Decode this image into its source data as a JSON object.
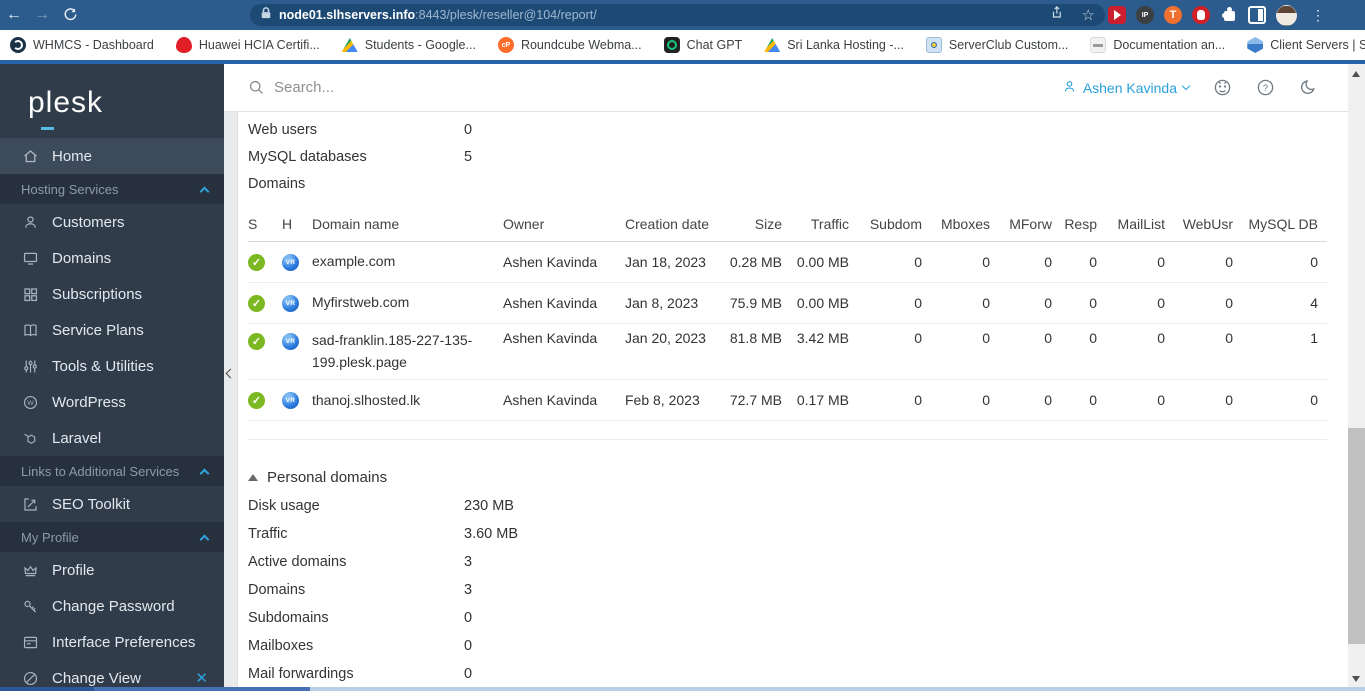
{
  "browser": {
    "url": {
      "host": "node01.slhservers.info",
      "rest": ":8443/plesk/reseller@104/report/"
    },
    "bookmarks": [
      {
        "label": "WHMCS - Dashboard"
      },
      {
        "label": "Huawei HCIA Certifi..."
      },
      {
        "label": "Students - Google..."
      },
      {
        "label": "Roundcube Webma..."
      },
      {
        "label": "Chat GPT"
      },
      {
        "label": "Sri Lanka Hosting -..."
      },
      {
        "label": "ServerClub Custom..."
      },
      {
        "label": "Documentation an..."
      },
      {
        "label": "Client Servers | Serv..."
      }
    ],
    "bookmarks_overflow": "»"
  },
  "sidebar": {
    "logo": "plesk",
    "items": {
      "home": "Home",
      "customers": "Customers",
      "domains": "Domains",
      "subscriptions": "Subscriptions",
      "service_plans": "Service Plans",
      "tools": "Tools & Utilities",
      "wordpress": "WordPress",
      "laravel": "Laravel",
      "seo": "SEO Toolkit",
      "profile": "Profile",
      "change_password": "Change Password",
      "interface_preferences": "Interface Preferences",
      "change_view": "Change View"
    },
    "sections": {
      "hosting": "Hosting Services",
      "links": "Links to Additional Services",
      "my_profile": "My Profile"
    },
    "change_view_close": "✕"
  },
  "header": {
    "search_placeholder": "Search...",
    "user_name": "Ashen Kavinda"
  },
  "main": {
    "stats_top": [
      {
        "label": "Web users",
        "value": "0"
      },
      {
        "label": "MySQL databases",
        "value": "5"
      }
    ],
    "domains_label": "Domains",
    "table": {
      "headers": {
        "s": "S",
        "h": "H",
        "domain": "Domain name",
        "owner": "Owner",
        "creation": "Creation date",
        "size": "Size",
        "traffic": "Traffic",
        "subdom": "Subdom",
        "mboxes": "Mboxes",
        "mforw": "MForw",
        "resp": "Resp",
        "maillist": "MailList",
        "webusr": "WebUsr",
        "mysqldb": "MySQL DB"
      },
      "status_check": "✓",
      "hosting_badge": "VR",
      "rows": [
        {
          "domain": "example.com",
          "owner": "Ashen Kavinda",
          "creation": "Jan 18, 2023",
          "size": "0.28 MB",
          "traffic": "0.00 MB",
          "subdom": "0",
          "mboxes": "0",
          "mforw": "0",
          "resp": "0",
          "maillist": "0",
          "webusr": "0",
          "mysqldb": "0"
        },
        {
          "domain": "Myfirstweb.com",
          "owner": "Ashen Kavinda",
          "creation": "Jan 8, 2023",
          "size": "75.9 MB",
          "traffic": "0.00 MB",
          "subdom": "0",
          "mboxes": "0",
          "mforw": "0",
          "resp": "0",
          "maillist": "0",
          "webusr": "0",
          "mysqldb": "4"
        },
        {
          "domain": "sad-franklin.185-227-135-199.plesk.page",
          "owner": "Ashen Kavinda",
          "creation": "Jan 20, 2023",
          "size": "81.8 MB",
          "traffic": "3.42 MB",
          "subdom": "0",
          "mboxes": "0",
          "mforw": "0",
          "resp": "0",
          "maillist": "0",
          "webusr": "0",
          "mysqldb": "1"
        },
        {
          "domain": "thanoj.slhosted.lk",
          "owner": "Ashen Kavinda",
          "creation": "Feb 8, 2023",
          "size": "72.7 MB",
          "traffic": "0.17 MB",
          "subdom": "0",
          "mboxes": "0",
          "mforw": "0",
          "resp": "0",
          "maillist": "0",
          "webusr": "0",
          "mysqldb": "0"
        }
      ]
    },
    "personal_domains": {
      "title": "Personal domains",
      "rows": [
        {
          "label": "Disk usage",
          "value": "230 MB"
        },
        {
          "label": "Traffic",
          "value": "3.60 MB"
        },
        {
          "label": "Active domains",
          "value": "3"
        },
        {
          "label": "Domains",
          "value": "3"
        },
        {
          "label": "Subdomains",
          "value": "0"
        },
        {
          "label": "Mailboxes",
          "value": "0"
        },
        {
          "label": "Mail forwardings",
          "value": "0"
        }
      ]
    }
  },
  "colors": {
    "accent_blue": "#28a2dc",
    "status_green": "#7cb821",
    "hosting_blue": "#2f7fe0",
    "chrome_theme": "#2b5c8d"
  }
}
